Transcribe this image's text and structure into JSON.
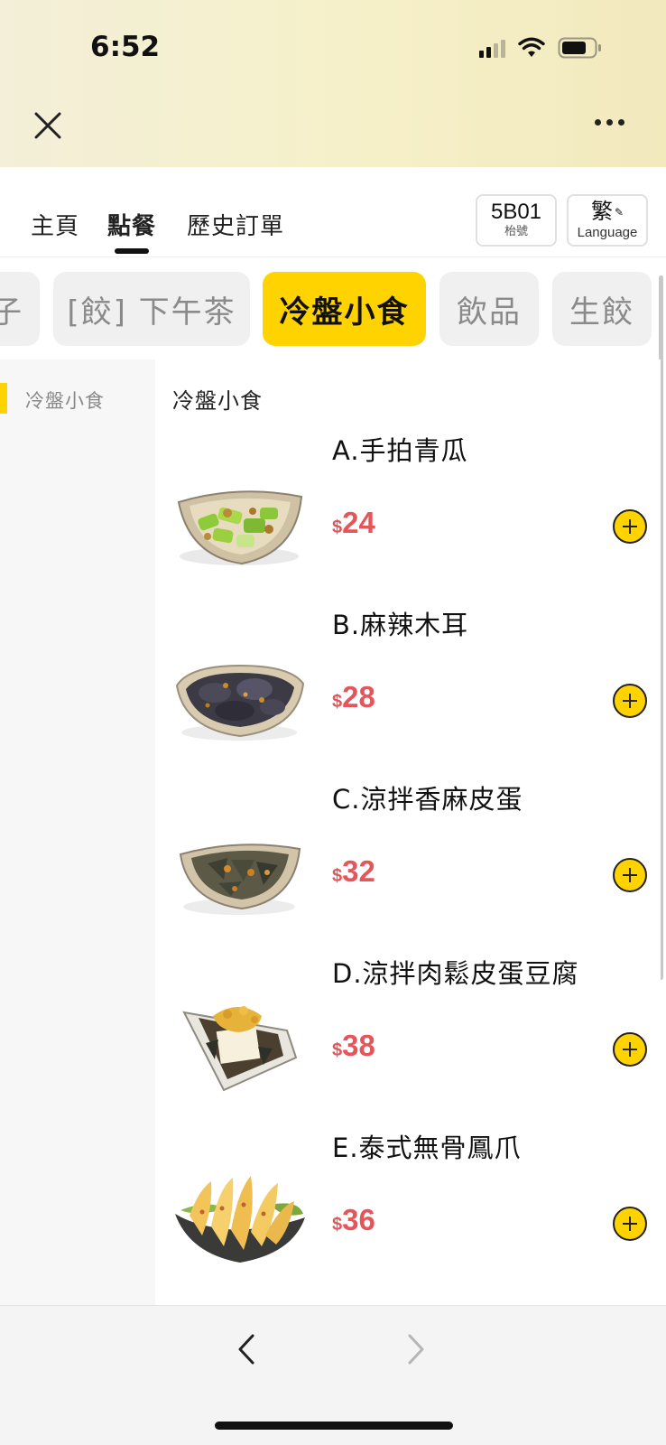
{
  "status": {
    "time": "6:52"
  },
  "nav": {
    "tabs": [
      {
        "label": "主頁"
      },
      {
        "label": "點餐"
      },
      {
        "label": "歷史訂單"
      }
    ],
    "table_number": "5B01",
    "table_label": "枱號",
    "lang_char": "繁",
    "lang_label": "Language"
  },
  "categories": [
    {
      "label": "子"
    },
    {
      "label": "[餃] 下午茶"
    },
    {
      "label": "冷盤小食",
      "active": true
    },
    {
      "label": "飲品"
    },
    {
      "label": "生餃"
    }
  ],
  "sidebar": {
    "items": [
      {
        "label": "冷盤小食"
      }
    ]
  },
  "section": {
    "title": "冷盤小食"
  },
  "items": [
    {
      "name": "A.手拍青瓜",
      "currency": "$",
      "price": "24"
    },
    {
      "name": "B.麻辣木耳",
      "currency": "$",
      "price": "28"
    },
    {
      "name": "C.涼拌香麻皮蛋",
      "currency": "$",
      "price": "32"
    },
    {
      "name": "D.涼拌肉鬆皮蛋豆腐",
      "currency": "$",
      "price": "38"
    },
    {
      "name": "E.泰式無骨鳳爪",
      "currency": "$",
      "price": "36"
    }
  ],
  "colors": {
    "accent": "#ffd300",
    "price": "#e5565b"
  }
}
